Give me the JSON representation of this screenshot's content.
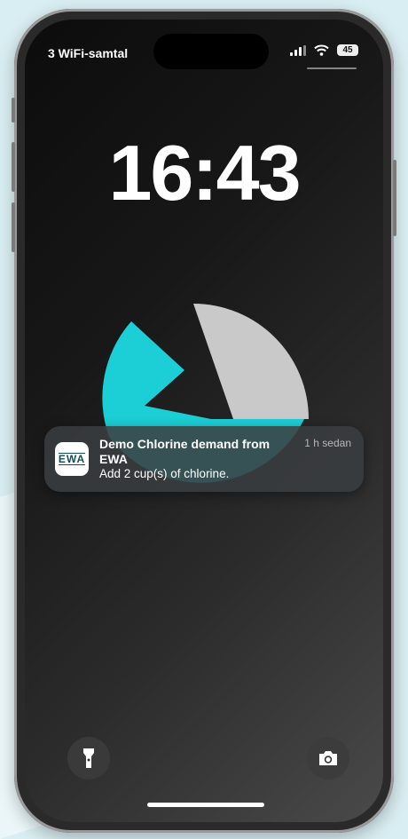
{
  "status_bar": {
    "carrier": "3 WiFi-samtal",
    "battery_level": "45"
  },
  "lock_screen": {
    "time": "16:43"
  },
  "notification": {
    "app_icon_text": "EWA",
    "title": "Demo  Chlorine demand from EWA",
    "time": "1 h sedan",
    "body": "Add 2 cup(s) of chlorine."
  },
  "quick_actions": {
    "left_icon": "flashlight-icon",
    "right_icon": "camera-icon"
  },
  "colors": {
    "accent_teal": "#1ccfd6",
    "shape_gray": "#c9c9c9"
  }
}
